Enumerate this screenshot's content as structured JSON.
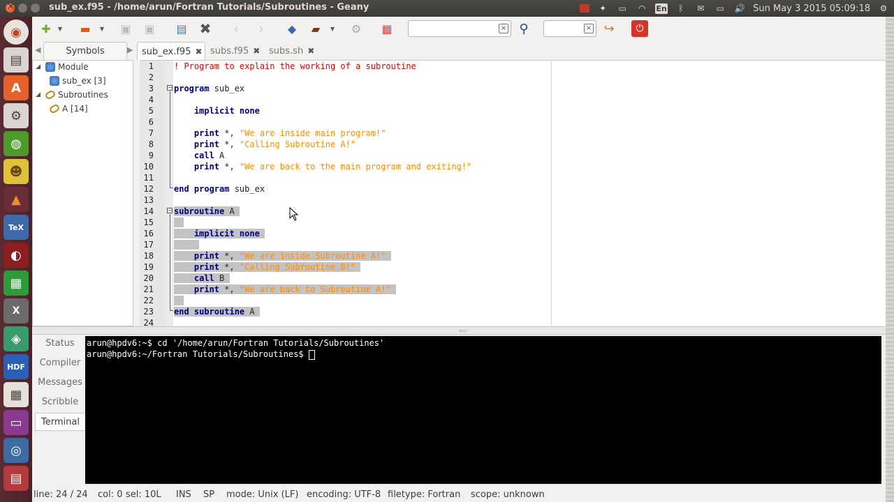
{
  "window": {
    "title": "sub_ex.f95 - /home/arun/Fortran Tutorials/Subroutines - Geany"
  },
  "tray": {
    "lang": "En",
    "clock": "Sun May  3 2015 05:09:18"
  },
  "sidebar": {
    "tab_label": "Symbols",
    "tree": [
      {
        "label": "Module",
        "icon": "module-icon"
      },
      {
        "label": "sub_ex [3]",
        "icon": "module-icon"
      },
      {
        "label": "Subroutines",
        "icon": "subroutine-icon"
      },
      {
        "label": "A [14]",
        "icon": "subroutine-icon"
      }
    ]
  },
  "tabs": [
    {
      "label": "sub_ex.f95"
    },
    {
      "label": "subs.f95"
    },
    {
      "label": "subs.sh"
    }
  ],
  "editor": {
    "line_numbers": [
      "1",
      "2",
      "3",
      "4",
      "5",
      "6",
      "7",
      "8",
      "9",
      "10",
      "11",
      "12",
      "13",
      "14",
      "15",
      "16",
      "17",
      "18",
      "19",
      "20",
      "21",
      "22",
      "23",
      "24"
    ],
    "lines": {
      "l1": "! Program to explain the working of a subroutine",
      "l3_kw": "program",
      "l3_rest": " sub_ex",
      "l5_kw": "implicit none",
      "l7_kw": "print",
      "l7_mid": " *, ",
      "l7_str": "\"We are inside main program!\"",
      "l8_kw": "print",
      "l8_mid": " *, ",
      "l8_str": "\"Calling Subroutine A!\"",
      "l9_kw": "call",
      "l9_rest": " A",
      "l10_kw": "print",
      "l10_mid": " *, ",
      "l10_str": "\"We are back to the main program and exiting!\"",
      "l12_kw": "end program",
      "l12_rest": " sub_ex",
      "l14_kw": "subroutine",
      "l14_rest": " A",
      "l16_kw": "implicit none",
      "l18_kw": "print",
      "l18_mid": " *, ",
      "l18_str": "\"We are inside Subroutine A!\"",
      "l19_kw": "print",
      "l19_mid": " *, ",
      "l19_str": "\"Calling Subroutine B!\"",
      "l20_kw": "call",
      "l20_rest": " B",
      "l21_kw": "print",
      "l21_mid": " *, ",
      "l21_str": "\"We are back to Subroutine A!\"",
      "l23_kw": "end subroutine",
      "l23_rest": " A"
    }
  },
  "message_tabs": [
    "Status",
    "Compiler",
    "Messages",
    "Scribble",
    "Terminal"
  ],
  "terminal": {
    "line1": "arun@hpdv6:~$ cd '/home/arun/Fortran Tutorials/Subroutines'",
    "line2": "arun@hpdv6:~/Fortran Tutorials/Subroutines$ "
  },
  "status": {
    "line": "line: 24 / 24",
    "col": "col: 0",
    "sel": "sel: 10L",
    "ins": "INS",
    "sp": "SP",
    "mode": "mode: Unix (LF)",
    "encoding": "encoding: UTF-8",
    "filetype": "filetype: Fortran",
    "scope": "scope: unknown"
  },
  "colors": {
    "keyword": "#00007f",
    "string": "#ff8c00",
    "comment": "#dd0000",
    "selection": "#c3c3c3",
    "launcher": "#5a2b33"
  }
}
